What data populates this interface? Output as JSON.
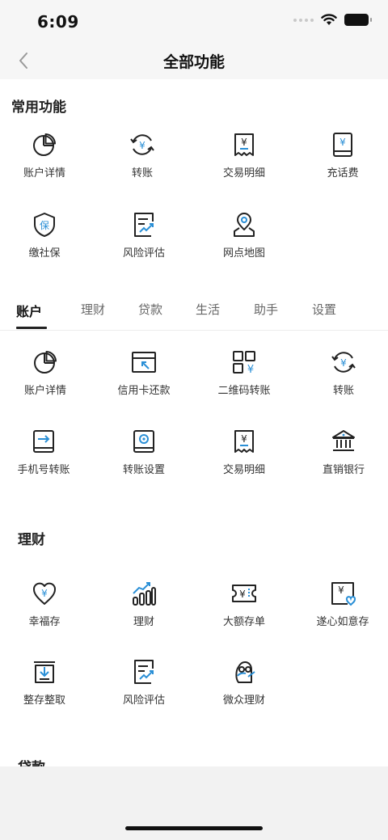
{
  "status_bar": {
    "time": "6:09"
  },
  "nav": {
    "title": "全部功能"
  },
  "common": {
    "title": "常用功能",
    "items": [
      {
        "label": "账户详情",
        "icon": "pie-chart-icon"
      },
      {
        "label": "转账",
        "icon": "transfer-yuan-icon"
      },
      {
        "label": "交易明细",
        "icon": "receipt-icon"
      },
      {
        "label": "充话费",
        "icon": "phone-topup-icon"
      },
      {
        "label": "缴社保",
        "icon": "shield-bao-icon"
      },
      {
        "label": "风险评估",
        "icon": "risk-chart-icon"
      },
      {
        "label": "网点地图",
        "icon": "map-pin-icon"
      }
    ]
  },
  "tabs": [
    {
      "label": "账户"
    },
    {
      "label": "理财"
    },
    {
      "label": "贷款"
    },
    {
      "label": "生活"
    },
    {
      "label": "助手"
    },
    {
      "label": "设置"
    }
  ],
  "account": {
    "items": [
      {
        "label": "账户详情",
        "icon": "pie-chart-icon"
      },
      {
        "label": "信用卡还款",
        "icon": "credit-card-repay-icon"
      },
      {
        "label": "二维码转账",
        "icon": "qr-code-icon"
      },
      {
        "label": "转账",
        "icon": "transfer-yuan-icon"
      },
      {
        "label": "手机号转账",
        "icon": "phone-transfer-icon"
      },
      {
        "label": "转账设置",
        "icon": "transfer-settings-icon"
      },
      {
        "label": "交易明细",
        "icon": "receipt-icon"
      },
      {
        "label": "直销银行",
        "icon": "bank-icon"
      }
    ]
  },
  "wealth": {
    "title": "理财",
    "items": [
      {
        "label": "幸福存",
        "icon": "heart-yuan-icon"
      },
      {
        "label": "理财",
        "icon": "bar-chart-icon"
      },
      {
        "label": "大额存单",
        "icon": "ticket-yuan-icon"
      },
      {
        "label": "遂心如意存",
        "icon": "yuan-heart-card-icon"
      },
      {
        "label": "整存整取",
        "icon": "deposit-box-icon"
      },
      {
        "label": "风险评估",
        "icon": "risk-chart-icon"
      },
      {
        "label": "微众理财",
        "icon": "mascot-icon"
      }
    ]
  },
  "loan": {
    "title": "贷款"
  },
  "colors": {
    "accent": "#2a8fd6",
    "line": "#222222"
  }
}
